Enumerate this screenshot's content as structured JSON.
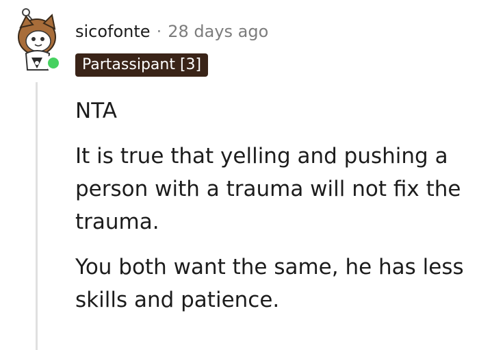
{
  "comment": {
    "username": "sicofonte",
    "separator": "·",
    "timestamp": "28 days ago",
    "flair": "Partassipant [3]",
    "status": "online",
    "paragraphs": [
      "NTA",
      "It is true that yelling and pushing a person with a trauma will not fix the trauma.",
      "You both want the same, he has less skills and patience."
    ]
  },
  "colors": {
    "online_indicator": "#46d160",
    "flair_background": "#3a2418",
    "timestamp": "#7c7c7c",
    "thread_line": "#e0e0e0"
  },
  "icons": {
    "avatar": "snoo-avatar-icon"
  }
}
